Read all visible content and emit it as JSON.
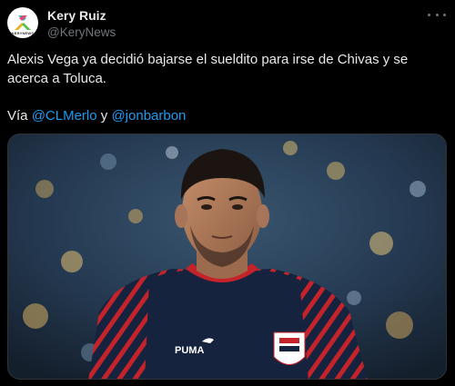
{
  "author": {
    "display_name": "Kery Ruiz",
    "handle": "@KeryNews",
    "avatar_brand": "KERYNEWS"
  },
  "tweet": {
    "text": "Alexis Vega ya decidió bajarse el sueldito para irse de Chivas y se acerca a Toluca.",
    "via_prefix": "Vía ",
    "mention_1": "@CLMerlo",
    "via_joiner": " y ",
    "mention_2": "@jonbarbon"
  },
  "media": {
    "jersey_sponsor": "PUMA"
  },
  "colors": {
    "background": "#000000",
    "text_primary": "#e7e9ea",
    "text_secondary": "#71767b",
    "link": "#1d9bf0",
    "jersey_navy": "#16233f",
    "jersey_red": "#c4232a"
  },
  "icons": [
    "kerynews-logo-icon",
    "more-options-icon",
    "puma-logo-icon",
    "chivas-crest-icon"
  ]
}
